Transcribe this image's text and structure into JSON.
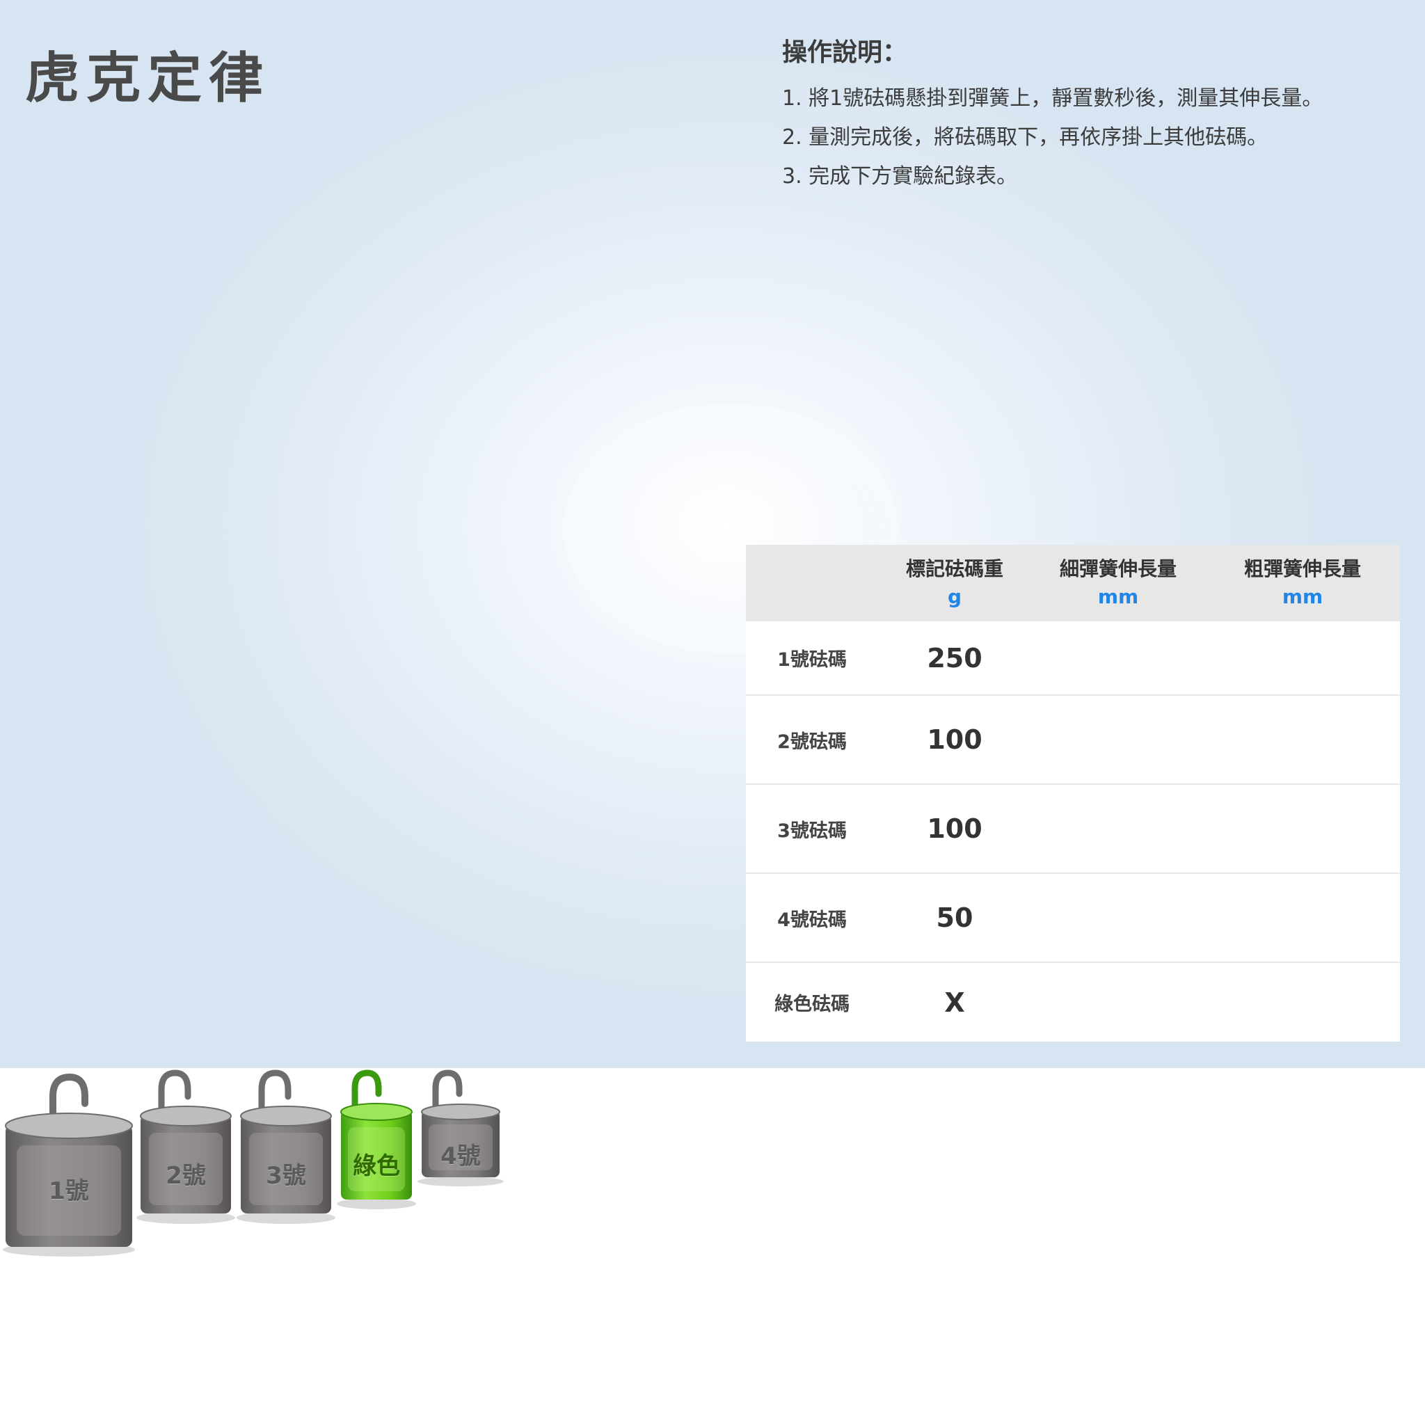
{
  "title": "虎克定律",
  "instructions": {
    "heading": "操作說明：",
    "steps": [
      "1. 將1號砝碼懸掛到彈簧上，靜置數秒後，測量其伸長量。",
      "2. 量測完成後，將砝碼取下，再依序掛上其他砝碼。",
      "3. 完成下方實驗紀錄表。"
    ]
  },
  "table": {
    "headers": [
      {
        "name": "標記砝碼重",
        "unit": "g"
      },
      {
        "name": "細彈簧伸長量",
        "unit": "mm"
      },
      {
        "name": "粗彈簧伸長量",
        "unit": "mm"
      }
    ],
    "rows": [
      {
        "label": "1號砝碼",
        "weight": "250",
        "thin": "",
        "thick": ""
      },
      {
        "label": "2號砝碼",
        "weight": "100",
        "thin": "",
        "thick": ""
      },
      {
        "label": "3號砝碼",
        "weight": "100",
        "thin": "",
        "thick": ""
      },
      {
        "label": "4號砝碼",
        "weight": "50",
        "thin": "",
        "thick": ""
      },
      {
        "label": "綠色砝碼",
        "weight": "X",
        "thin": "",
        "thick": ""
      }
    ]
  },
  "weights": [
    {
      "label": "1號",
      "color": "gray"
    },
    {
      "label": "2號",
      "color": "gray"
    },
    {
      "label": "3號",
      "color": "gray"
    },
    {
      "label": "綠色",
      "color": "green"
    },
    {
      "label": "4號",
      "color": "gray"
    }
  ],
  "colors": {
    "title": "#4a4a4a",
    "unit_text": "#1f86e8",
    "table_header_bg": "#e7e7e7",
    "weight_gray": "#7d7a7a",
    "weight_green": "#6fcf1a"
  }
}
